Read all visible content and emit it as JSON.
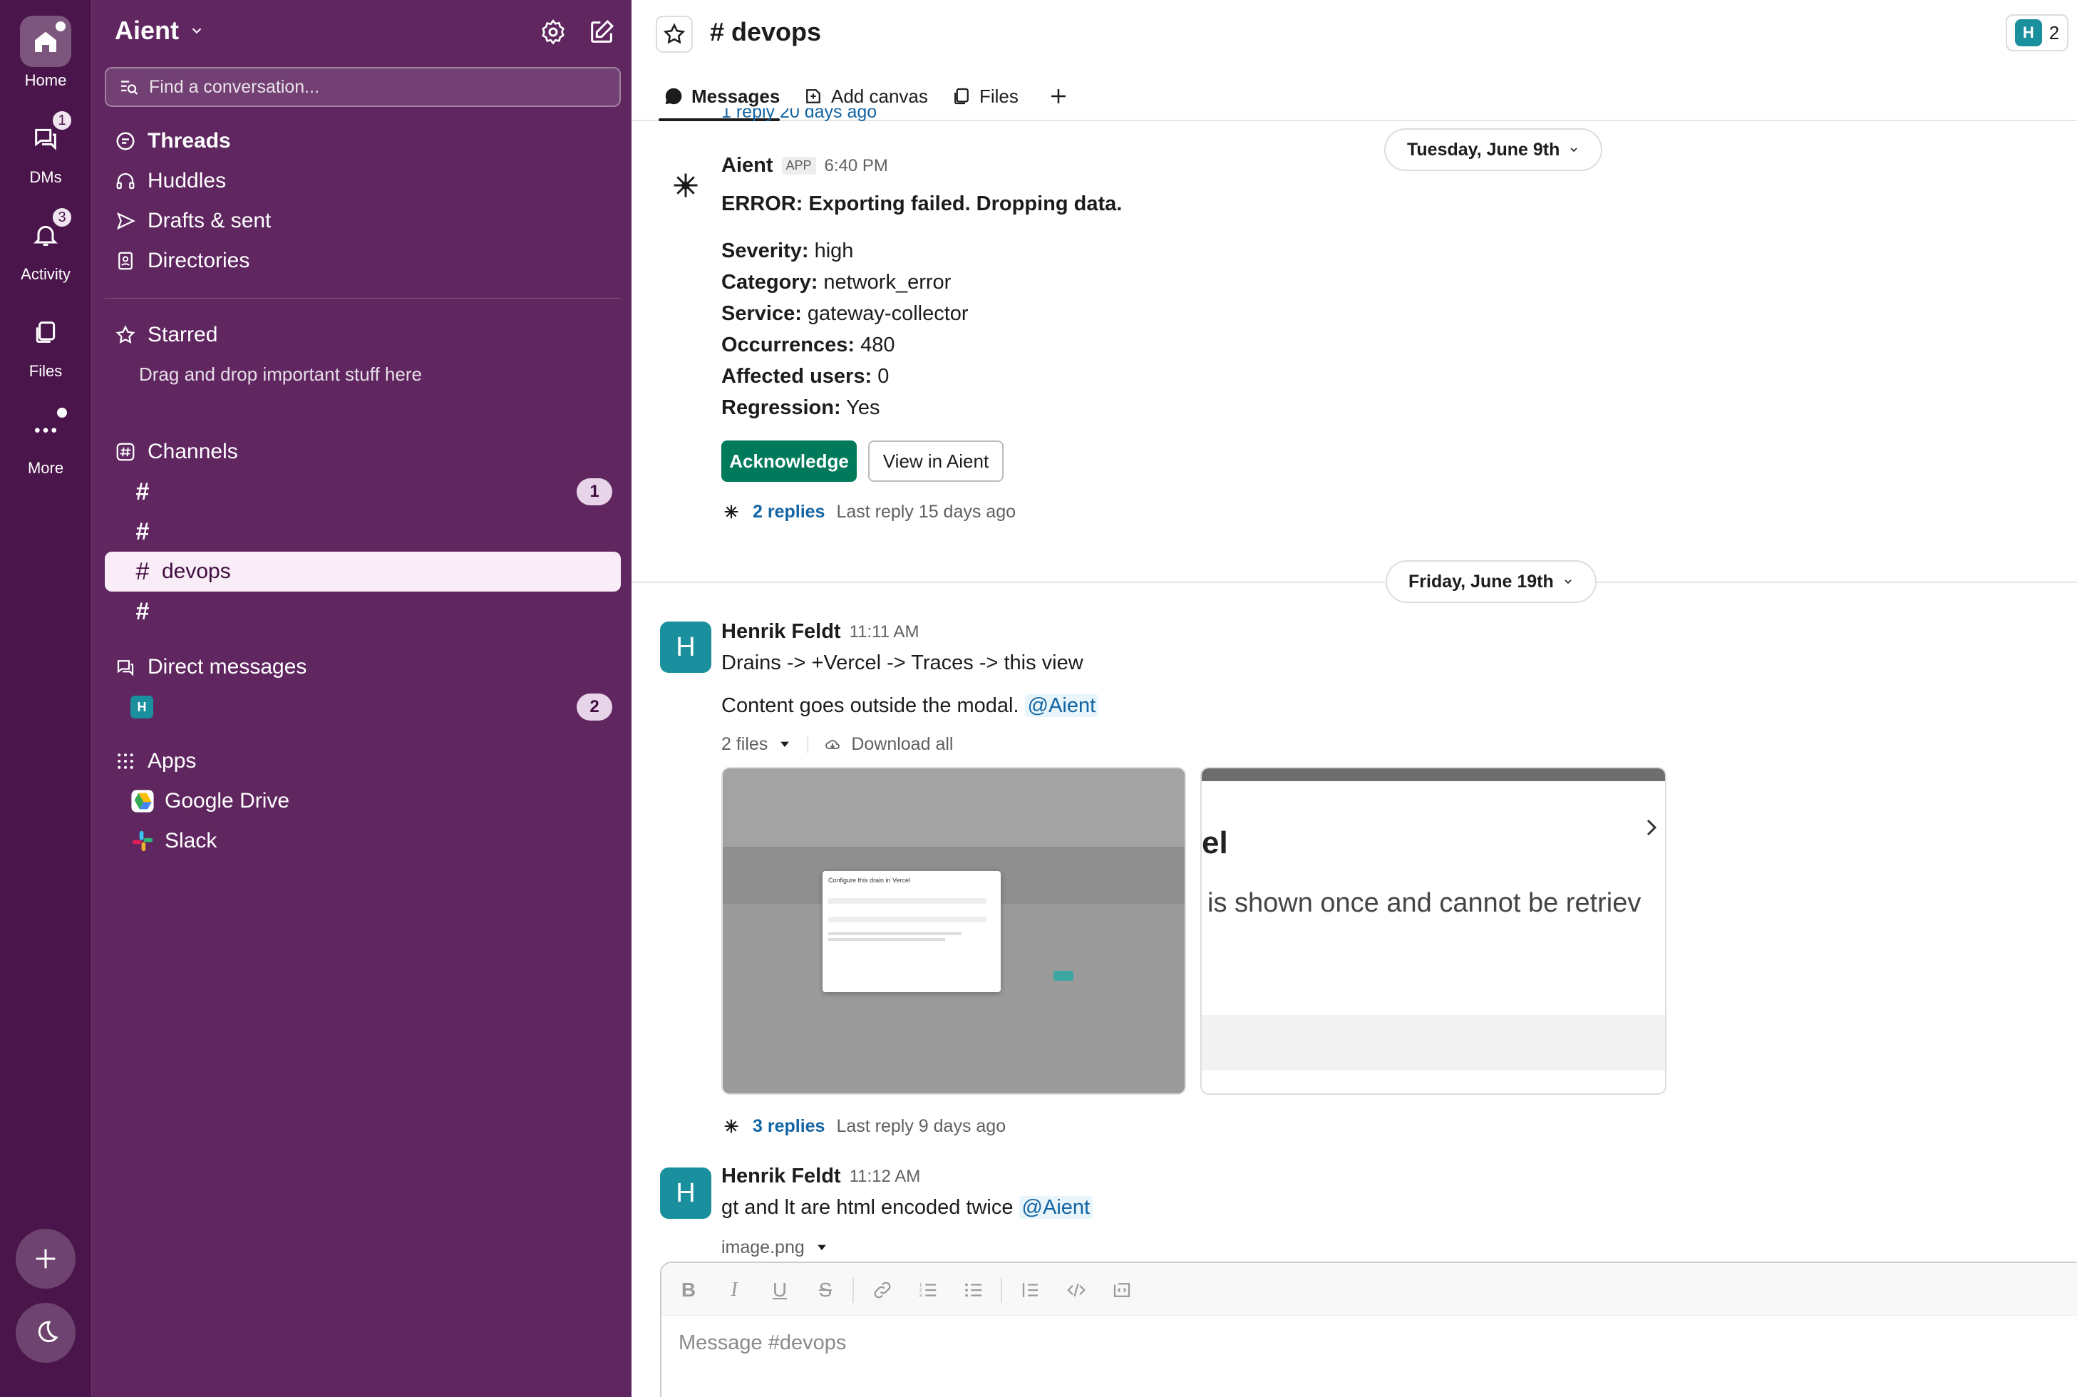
{
  "rail": {
    "home": "Home",
    "dms": "DMs",
    "dms_badge": "1",
    "activity": "Activity",
    "activity_badge": "3",
    "files": "Files",
    "more": "More"
  },
  "sidebar": {
    "workspace": "Aient",
    "search_placeholder": "Find a conversation...",
    "nav": [
      {
        "label": "Threads"
      },
      {
        "label": "Huddles"
      },
      {
        "label": "Drafts & sent"
      },
      {
        "label": "Directories"
      }
    ],
    "starred_label": "Starred",
    "starred_hint": "Drag and drop important stuff here",
    "channels_label": "Channels",
    "channels": [
      {
        "name": "",
        "badge": "1"
      },
      {
        "name": "",
        "badge": ""
      },
      {
        "name": "devops",
        "badge": ""
      },
      {
        "name": "",
        "badge": ""
      }
    ],
    "dm_label": "Direct messages",
    "dm_avatar": "H",
    "dm_badge": "2",
    "apps_label": "Apps",
    "apps": [
      {
        "name": "Google Drive"
      },
      {
        "name": "Slack"
      }
    ]
  },
  "header": {
    "channel": "# devops",
    "member_avatar": "H",
    "member_count": "2",
    "tabs": [
      {
        "label": "Messages"
      },
      {
        "label": "Add canvas"
      },
      {
        "label": "Files"
      }
    ],
    "top_partial": "1 reply  20 days ago"
  },
  "messages": {
    "date1": "Tuesday, June 9th",
    "m1": {
      "author": "Aient",
      "tag": "APP",
      "time": "6:40 PM",
      "title": "ERROR: Exporting failed. Dropping data.",
      "fields": [
        {
          "k": "Severity:",
          "v": "high"
        },
        {
          "k": "Category:",
          "v": "network_error"
        },
        {
          "k": "Service:",
          "v": "gateway-collector"
        },
        {
          "k": "Occurrences:",
          "v": "480"
        },
        {
          "k": "Affected users:",
          "v": "0"
        },
        {
          "k": "Regression:",
          "v": "Yes"
        }
      ],
      "btn_ack": "Acknowledge",
      "btn_view": "View in Aient",
      "replies": "2 replies",
      "last_reply": "Last reply 15 days ago"
    },
    "date2": "Friday, June 19th",
    "m2": {
      "avatar": "H",
      "author": "Henrik Feldt",
      "time": "11:11 AM",
      "line1": "Drains -> +Vercel -> Traces -> this view",
      "line2": "Content goes outside the modal.",
      "mention": "@Aient",
      "files_count": "2 files",
      "download_all": "Download all",
      "thumb1_modal_title": "Configure this drain in Vercel",
      "thumb2_text1": "el",
      "thumb2_text2": "is shown once and cannot be retriev",
      "replies": "3 replies",
      "last_reply": "Last reply 9 days ago"
    },
    "m3": {
      "avatar": "H",
      "author": "Henrik Feldt",
      "time": "11:12 AM",
      "text": "gt and lt are html encoded twice",
      "mention": "@Aient",
      "file": "image.png"
    }
  },
  "composer": {
    "placeholder": "Message #devops"
  }
}
